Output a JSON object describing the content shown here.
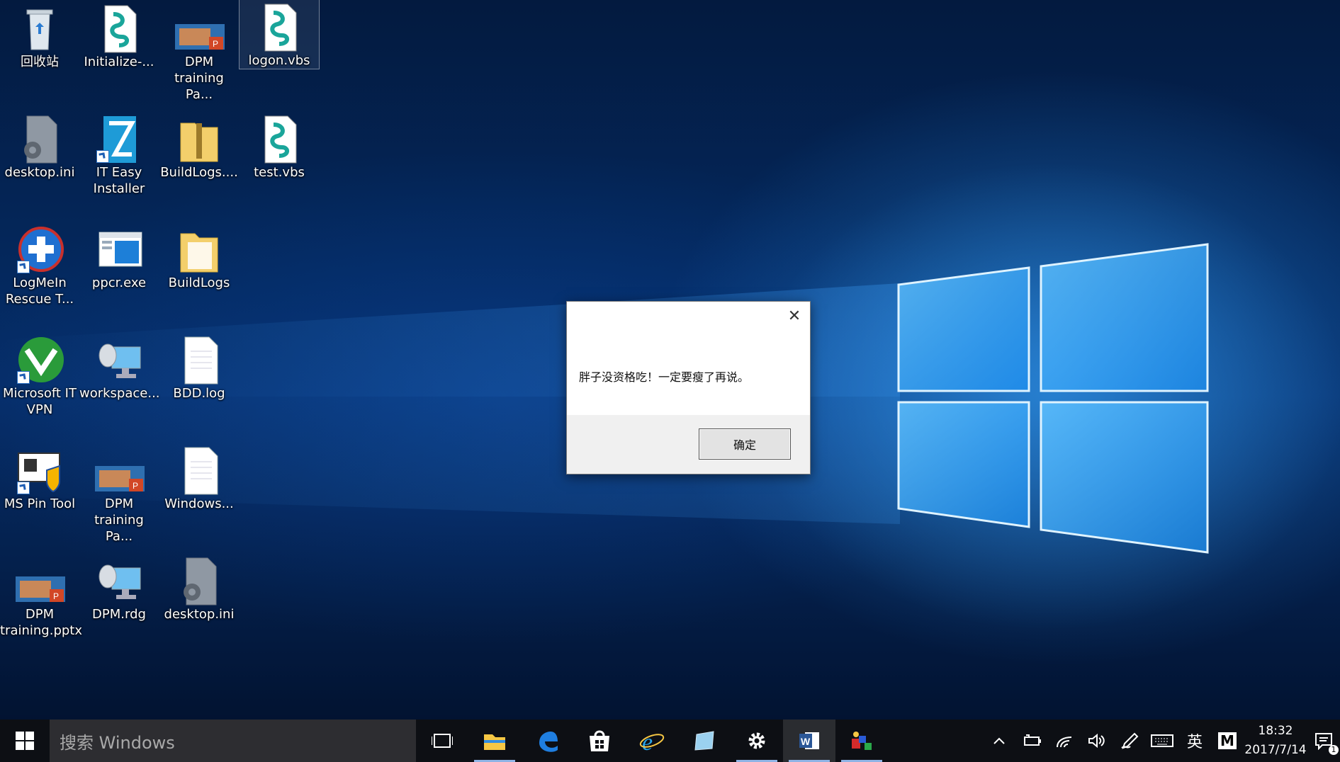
{
  "desktop": {
    "icons": [
      {
        "label": "回收站",
        "type": "recycle-bin"
      },
      {
        "label": "Initialize-...",
        "type": "vbs-script"
      },
      {
        "label": "DPM training Pa...",
        "type": "pptx-file"
      },
      {
        "label": "logon.vbs",
        "type": "vbs-script",
        "selected": true
      },
      {
        "label": "desktop.ini",
        "type": "ini-file"
      },
      {
        "label": "IT Easy Installer",
        "type": "shortcut-app"
      },
      {
        "label": "BuildLogs....",
        "type": "zip-folder"
      },
      {
        "label": "test.vbs",
        "type": "vbs-script"
      },
      {
        "label": "LogMeIn Rescue T...",
        "type": "shortcut-app"
      },
      {
        "label": "ppcr.exe",
        "type": "exe-file"
      },
      {
        "label": "BuildLogs",
        "type": "folder"
      },
      {
        "label": "Microsoft IT VPN",
        "type": "shortcut-app"
      },
      {
        "label": "workspace...",
        "type": "rdp-file"
      },
      {
        "label": "BDD.log",
        "type": "text-file"
      },
      {
        "label": "MS Pin Tool",
        "type": "shortcut-app"
      },
      {
        "label": "DPM training Pa...",
        "type": "pptx-file"
      },
      {
        "label": "Windows...",
        "type": "text-file"
      },
      {
        "label": "DPM training.pptx",
        "type": "pptx-file"
      },
      {
        "label": "DPM.rdg",
        "type": "rdp-file"
      },
      {
        "label": "desktop.ini",
        "type": "ini-file"
      }
    ]
  },
  "dialog": {
    "message": "胖子没资格吃！一定要瘦了再说。",
    "ok_label": "确定",
    "close_glyph": "✕"
  },
  "taskbar": {
    "search_placeholder": "搜索 Windows",
    "apps": [
      "task-view",
      "file-explorer",
      "edge",
      "store",
      "internet-explorer",
      "notepad-app",
      "settings",
      "word",
      "paint-app"
    ],
    "tray": {
      "ime_label": "英",
      "ime_mode": "M",
      "time": "18:32",
      "date": "2017/7/14",
      "notification_count": "1"
    }
  },
  "colors": {
    "taskbar": "#0d0f14",
    "search_box": "#2d2d31",
    "accent": "#1a8cff"
  }
}
